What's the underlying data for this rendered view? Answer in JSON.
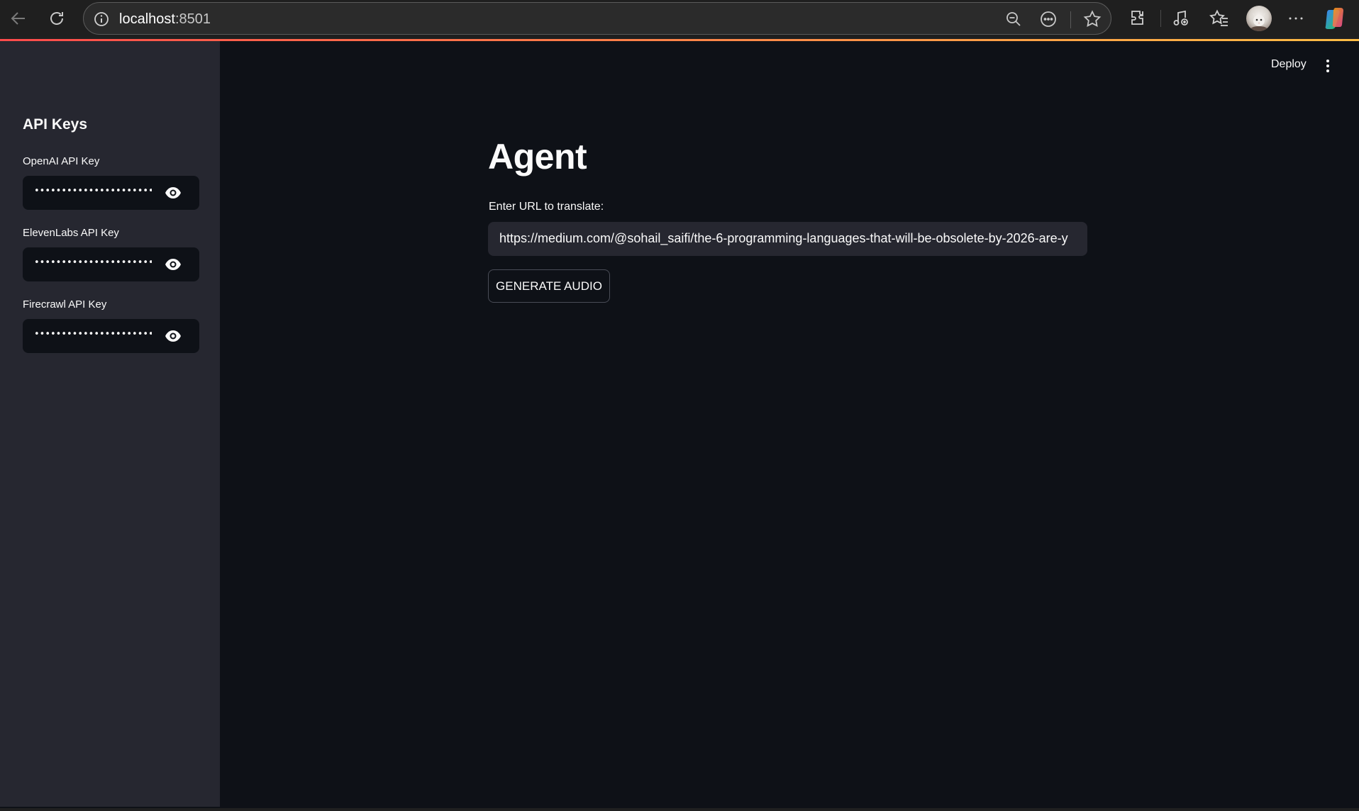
{
  "browser": {
    "url_host": "localhost",
    "url_port": ":8501",
    "icons": [
      "back-icon",
      "refresh-icon",
      "site-info-icon",
      "zoom-out-icon",
      "reading-mode-icon",
      "favorite-star-icon",
      "extensions-icon",
      "media-icon",
      "favorites-icon",
      "profile-avatar",
      "more-icon",
      "copilot-icon"
    ]
  },
  "header": {
    "deploy_label": "Deploy"
  },
  "sidebar": {
    "title": "API Keys",
    "fields": [
      {
        "label": "OpenAI API Key",
        "value": "••••••••••••••••••••••••••••"
      },
      {
        "label": "ElevenLabs API Key",
        "value": "••••••••••••••••••••••••••••"
      },
      {
        "label": "Firecrawl API Key",
        "value": "••••••••••••••••••••••••••••"
      }
    ]
  },
  "main": {
    "title": "Agent",
    "url_label": "Enter URL to translate:",
    "url_value": "https://medium.com/@sohail_saifi/the-6-programming-languages-that-will-be-obsolete-by-2026-are-y",
    "generate_label": "GENERATE AUDIO"
  },
  "colors": {
    "app_bg": "#0e1117",
    "sidebar_bg": "#262730",
    "text": "#fafafa",
    "accent_gradient_start": "#ff4b4b",
    "accent_gradient_end": "#ffbd45"
  }
}
